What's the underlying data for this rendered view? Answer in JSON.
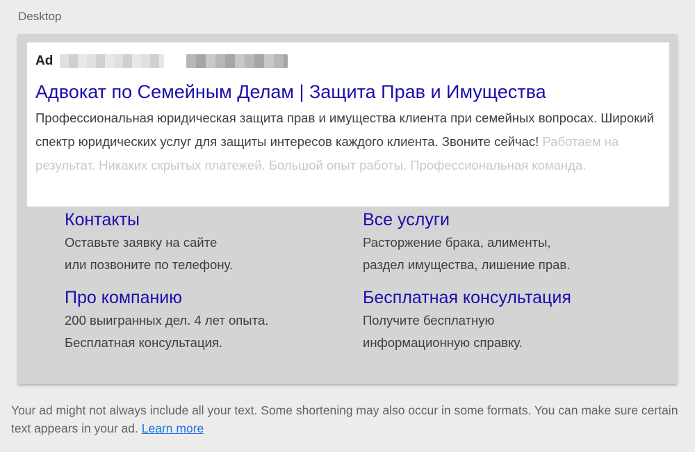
{
  "section": {
    "label": "Desktop"
  },
  "ad": {
    "badge": "Ad",
    "headline": "Адвокат по Семейным Делам | Защита Прав и Имущества",
    "description_visible": "Профессиональная юридическая защита прав и имущества клиента при семейных вопросах. Широкий спектр юридических услуг для защиты интересов каждого клиента. Звоните сейчас!",
    "description_faded": "Работаем на результат. Никаких скрытых платежей. Большой опыт работы. Профессиональная команда."
  },
  "sitelinks": [
    {
      "title": "Контакты",
      "line1": "Оставьте заявку на сайте",
      "line2": "или позвоните по телефону."
    },
    {
      "title": "Все услуги",
      "line1": "Расторжение брака, алименты,",
      "line2": "раздел имущества, лишение прав."
    },
    {
      "title": "Про компанию",
      "line1": "200 выигранных дел. 4 лет опыта.",
      "line2": "Бесплатная консультация."
    },
    {
      "title": "Бесплатная консультация",
      "line1": "Получите бесплатную",
      "line2": "информационную справку."
    }
  ],
  "footer": {
    "note": "Your ad might not always include all your text. Some shortening may also occur in some formats. You can make sure certain text appears in your ad.",
    "link_label": "Learn more"
  },
  "colors": {
    "link_blue": "#1a0dab",
    "learn_more_blue": "#1a73e8",
    "frame_gray": "#d4d4d4",
    "page_bg": "#ececec"
  }
}
